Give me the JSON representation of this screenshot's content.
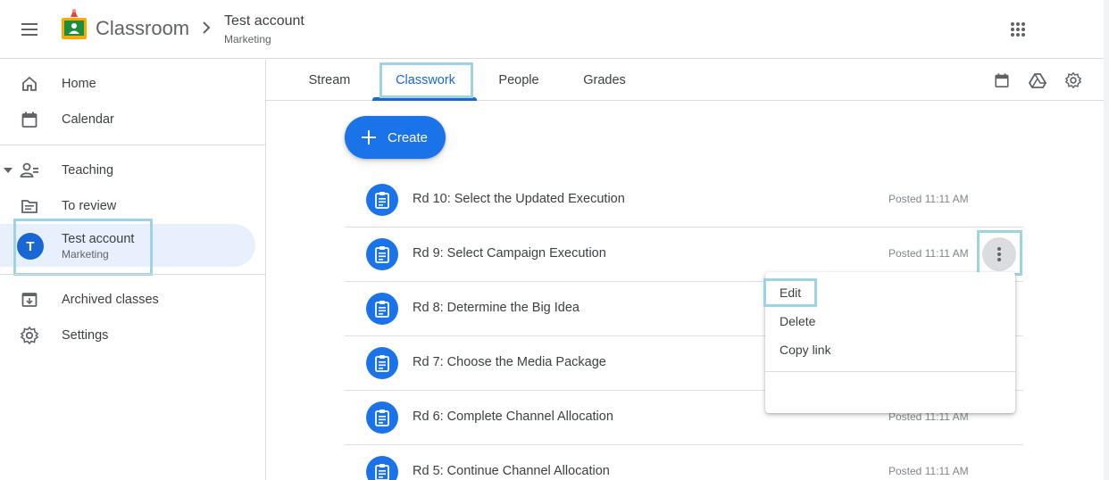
{
  "header": {
    "app_name": "Classroom",
    "class_title": "Test account",
    "class_section": "Marketing"
  },
  "sidebar": {
    "home": "Home",
    "calendar": "Calendar",
    "teaching": "Teaching",
    "to_review": "To review",
    "class": {
      "avatar_letter": "T",
      "name": "Test account",
      "section": "Marketing"
    },
    "archived": "Archived classes",
    "settings": "Settings"
  },
  "tabs": [
    {
      "label": "Stream"
    },
    {
      "label": "Classwork"
    },
    {
      "label": "People"
    },
    {
      "label": "Grades"
    }
  ],
  "active_tab": "Classwork",
  "create_button": "Create",
  "assignments": [
    {
      "title": "Rd 10: Select the Updated Execution",
      "posted": "Posted 11:11 AM"
    },
    {
      "title": "Rd 9: Select Campaign Execution",
      "posted": "Posted 11:11 AM"
    },
    {
      "title": "Rd 8: Determine the Big Idea",
      "posted": ""
    },
    {
      "title": "Rd 7: Choose the Media Package",
      "posted": ""
    },
    {
      "title": "Rd 6: Complete Channel Allocation",
      "posted": "Posted 11:11 AM"
    },
    {
      "title": "Rd 5: Continue Channel Allocation",
      "posted": "Posted 11:11 AM"
    }
  ],
  "context_menu": {
    "edit": "Edit",
    "delete": "Delete",
    "copy_link": "Copy link"
  },
  "colors": {
    "accent": "#1a73e8",
    "active_tab": "#1967d2",
    "highlight": "#9ed3e3",
    "selected_bg": "#e8f0fe"
  },
  "icons": [
    "menu-icon",
    "classroom-logo",
    "chevron-right-icon",
    "apps-grid-icon",
    "home-icon",
    "calendar-icon",
    "teaching-icon",
    "to-review-icon",
    "archive-icon",
    "settings-icon",
    "drive-icon",
    "assignment-icon",
    "more-vert-icon",
    "plus-icon"
  ]
}
